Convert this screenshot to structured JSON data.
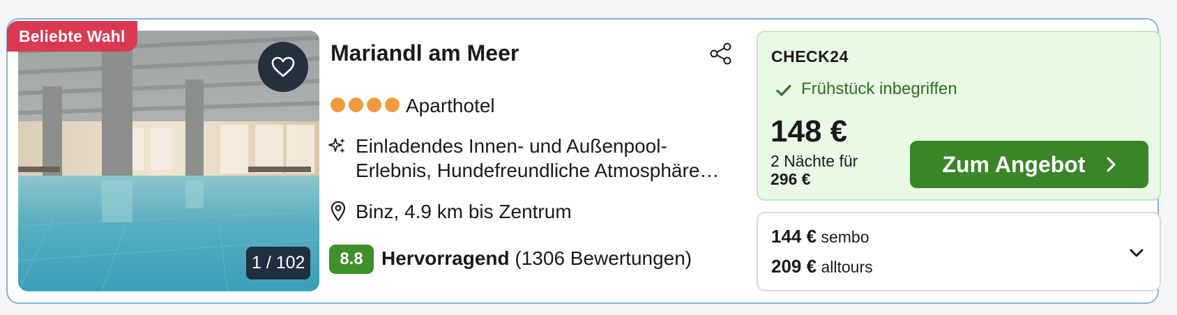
{
  "card": {
    "badge": "Beliebte Wahl",
    "image": {
      "counter": "1 / 102"
    },
    "hotel": {
      "name": "Mariandl am Meer",
      "stars": 4,
      "category": "Aparthotel",
      "highlights_line1": "Einladendes Innen- und Außenpool-",
      "highlights_line2": "Erlebnis, Hundefreundliche Atmosphäre…",
      "location": "Binz, 4.9 km bis Zentrum",
      "score": "8.8",
      "rating_label": "Hervorragend",
      "reviews": "(1306 Bewertungen)"
    },
    "offer": {
      "provider": "CHECK24",
      "perk": "Frühstück inbegriffen",
      "price": "148 €",
      "nights": "2 Nächte für",
      "total": "296 €",
      "cta_label": "Zum Angebot"
    },
    "alternatives": [
      {
        "price": "144 €",
        "provider": "sembo"
      },
      {
        "price": "209 €",
        "provider": "alltours"
      }
    ]
  },
  "colors": {
    "badge": "#d93a52",
    "star": "#f19a3e",
    "score": "#3f8f2a",
    "cta": "#3a8527",
    "offer_bg": "#e9f9e6",
    "card_border": "#7eb3e3"
  }
}
